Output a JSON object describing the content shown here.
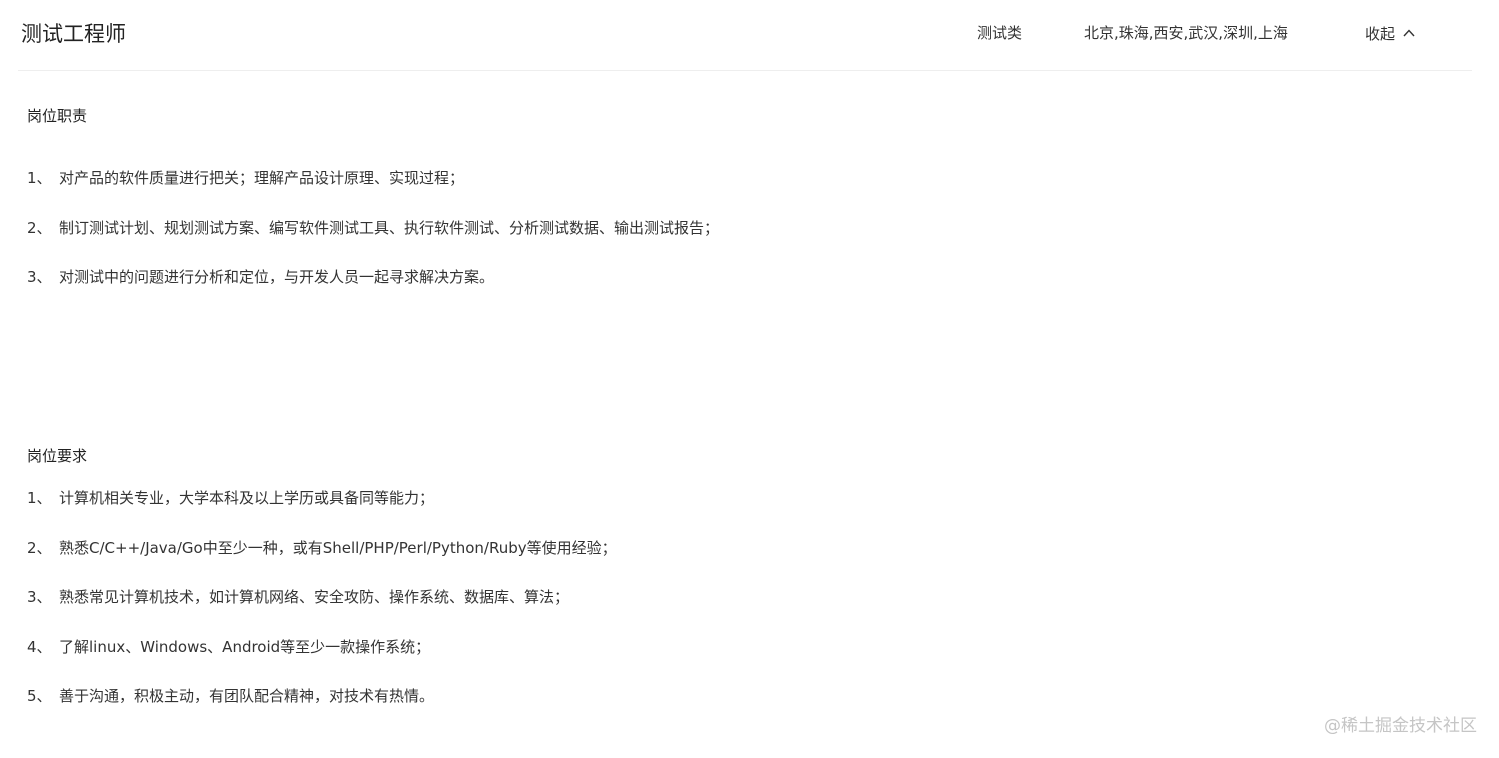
{
  "header": {
    "title": "测试工程师",
    "category": "测试类",
    "locations": "北京,珠海,西安,武汉,深圳,上海",
    "collapse_label": "收起"
  },
  "responsibilities": {
    "title": "岗位职责",
    "items": [
      {
        "num": "1、",
        "text": "对产品的软件质量进行把关；理解产品设计原理、实现过程；"
      },
      {
        "num": "2、",
        "text": "制订测试计划、规划测试方案、编写软件测试工具、执行软件测试、分析测试数据、输出测试报告；"
      },
      {
        "num": "3、",
        "text": "对测试中的问题进行分析和定位，与开发人员一起寻求解决方案。"
      }
    ]
  },
  "requirements": {
    "title": "岗位要求",
    "items": [
      {
        "num": "1、",
        "text": "计算机相关专业，大学本科及以上学历或具备同等能力；"
      },
      {
        "num": "2、",
        "text": "熟悉C/C++/Java/Go中至少一种，或有Shell/PHP/Perl/Python/Ruby等使用经验；"
      },
      {
        "num": "3、",
        "text": "熟悉常见计算机技术，如计算机网络、安全攻防、操作系统、数据库、算法；"
      },
      {
        "num": "4、",
        "text": "了解linux、Windows、Android等至少一款操作系统；"
      },
      {
        "num": "5、",
        "text": "善于沟通，积极主动，有团队配合精神，对技术有热情。"
      }
    ]
  },
  "watermark": "@稀土掘金技术社区",
  "icons": {
    "collapse": "chevron-up-icon"
  }
}
